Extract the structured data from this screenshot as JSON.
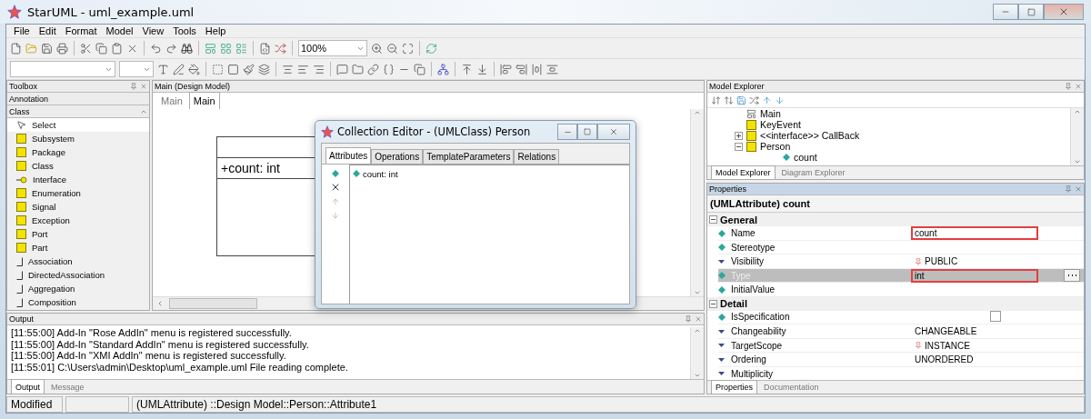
{
  "window": {
    "title": "StarUML - uml_example.uml"
  },
  "menu": [
    "File",
    "Edit",
    "Format",
    "Model",
    "View",
    "Tools",
    "Help"
  ],
  "toolbar": {
    "zoom": "100%"
  },
  "toolbox": {
    "title": "Toolbox",
    "groups": [
      {
        "label": "Annotation",
        "expanded": false
      },
      {
        "label": "Class",
        "expanded": true
      }
    ],
    "items": [
      {
        "label": "Select",
        "selected": true
      },
      {
        "label": "Subsystem",
        "selected": false
      },
      {
        "label": "Package",
        "selected": false
      },
      {
        "label": "Class",
        "selected": false
      },
      {
        "label": "Interface",
        "selected": false
      },
      {
        "label": "Enumeration",
        "selected": false
      },
      {
        "label": "Signal",
        "selected": false
      },
      {
        "label": "Exception",
        "selected": false
      },
      {
        "label": "Port",
        "selected": false
      },
      {
        "label": "Part",
        "selected": false
      },
      {
        "label": "Association",
        "selected": false
      },
      {
        "label": "DirectedAssociation",
        "selected": false
      },
      {
        "label": "Aggregation",
        "selected": false
      },
      {
        "label": "Composition",
        "selected": false
      }
    ]
  },
  "diagram": {
    "title": "Main (Design Model)",
    "tabs": [
      {
        "label": "Main",
        "selected": false
      },
      {
        "label": "Main",
        "selected": true
      }
    ],
    "class_attribute": "+count: int"
  },
  "dialog": {
    "title": "Collection Editor - (UMLClass) Person",
    "tabs": [
      {
        "label": "Attributes",
        "selected": true
      },
      {
        "label": "Operations",
        "selected": false
      },
      {
        "label": "TemplateParameters",
        "selected": false
      },
      {
        "label": "Relations",
        "selected": false
      }
    ],
    "items": [
      "count: int"
    ]
  },
  "model_explorer": {
    "title": "Model Explorer",
    "tree": [
      {
        "label": "Main",
        "kind": "diagram"
      },
      {
        "label": "KeyEvent",
        "kind": "class"
      },
      {
        "label": "<<interface>> CallBack",
        "kind": "class",
        "expanded": false
      },
      {
        "label": "Person",
        "kind": "class",
        "expanded": true,
        "children": [
          {
            "label": "count",
            "kind": "attribute"
          }
        ]
      }
    ],
    "tabs": [
      {
        "label": "Model Explorer",
        "selected": true
      },
      {
        "label": "Diagram Explorer",
        "selected": false
      }
    ]
  },
  "properties": {
    "title": "Properties",
    "heading": "(UMLAttribute) count",
    "sections": [
      {
        "label": "General",
        "expanded": true,
        "rows": [
          {
            "name": "Name",
            "value": "count",
            "kind": "text",
            "selected": false,
            "highlighted": true
          },
          {
            "name": "Stereotype",
            "kind": "text",
            "selected": false,
            "highlighted": false
          },
          {
            "name": "Visibility",
            "value": "PUBLIC",
            "kind": "enum",
            "selected": false,
            "highlighted": false
          },
          {
            "name": "Type",
            "value": "int",
            "kind": "text",
            "selected": true,
            "highlighted": true
          },
          {
            "name": "InitialValue",
            "kind": "text",
            "selected": false,
            "highlighted": false
          }
        ]
      },
      {
        "label": "Detail",
        "expanded": true,
        "rows": [
          {
            "name": "IsSpecification",
            "kind": "checkbox",
            "checked": false,
            "selected": false
          },
          {
            "name": "Changeability",
            "value": "CHANGEABLE",
            "kind": "enum",
            "selected": false,
            "highlighted": false
          },
          {
            "name": "TargetScope",
            "value": "INSTANCE",
            "kind": "enum",
            "selected": false,
            "highlighted": false
          },
          {
            "name": "Ordering",
            "value": "UNORDERED",
            "kind": "enum",
            "selected": false,
            "highlighted": false
          },
          {
            "name": "Multiplicity",
            "kind": "enum",
            "selected": false,
            "highlighted": false
          }
        ]
      }
    ],
    "tabs": [
      {
        "label": "Properties",
        "selected": true
      },
      {
        "label": "Documentation",
        "selected": false
      }
    ]
  },
  "output": {
    "title": "Output",
    "lines": [
      {
        "time": "[11:55:00]",
        "message": "Add-In \"Rose AddIn\" menu is registered successfully."
      },
      {
        "time": "[11:55:00]",
        "message": "Add-In \"Standard AddIn\" menu is registered successfully."
      },
      {
        "time": "[11:55:00]",
        "message": "Add-In \"XMI AddIn\" menu is registered successfully."
      },
      {
        "time": "[11:55:01]",
        "message": "C:\\Users\\admin\\Desktop\\uml_example.uml File reading complete."
      }
    ],
    "tabs": [
      {
        "label": "Output",
        "selected": true
      },
      {
        "label": "Message",
        "selected": false
      }
    ]
  },
  "status_bar": {
    "state": "Modified",
    "path": "(UMLAttribute) ::Design Model::Person::Attribute1"
  }
}
